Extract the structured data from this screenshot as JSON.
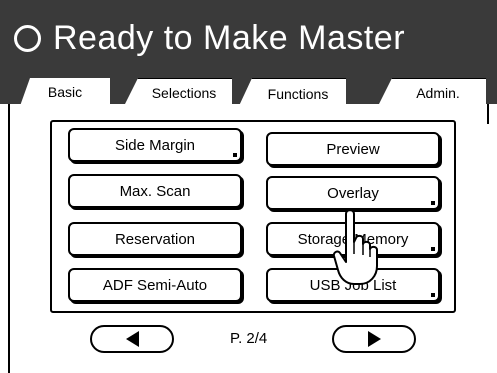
{
  "header": {
    "title": "Ready to Make Master",
    "status_icon": "ring-icon"
  },
  "tabs": [
    {
      "label": "Basic",
      "active": false
    },
    {
      "label": "Selections",
      "active": false
    },
    {
      "label": "Functions",
      "active": true
    },
    {
      "label": "Admin.",
      "active": false
    }
  ],
  "functions": [
    {
      "label": "Side Margin",
      "has_corner_mark": true
    },
    {
      "label": "Preview",
      "has_corner_mark": false
    },
    {
      "label": "Max. Scan",
      "has_corner_mark": false
    },
    {
      "label": "Overlay",
      "has_corner_mark": true
    },
    {
      "label": "Reservation",
      "has_corner_mark": false
    },
    {
      "label": "Storage Memory",
      "has_corner_mark": true
    },
    {
      "label": "ADF Semi-Auto",
      "has_corner_mark": false
    },
    {
      "label": "USB Job List",
      "has_corner_mark": true
    }
  ],
  "pagination": {
    "page_label": "P. 2/4",
    "prev_icon": "triangle-left-icon",
    "next_icon": "triangle-right-icon"
  },
  "colors": {
    "header_bg": "#3a3a3a",
    "header_text": "#ffffff",
    "body_bg": "#ffffff",
    "outline": "#000000"
  },
  "pointer_icon": "hand-pointer-icon"
}
